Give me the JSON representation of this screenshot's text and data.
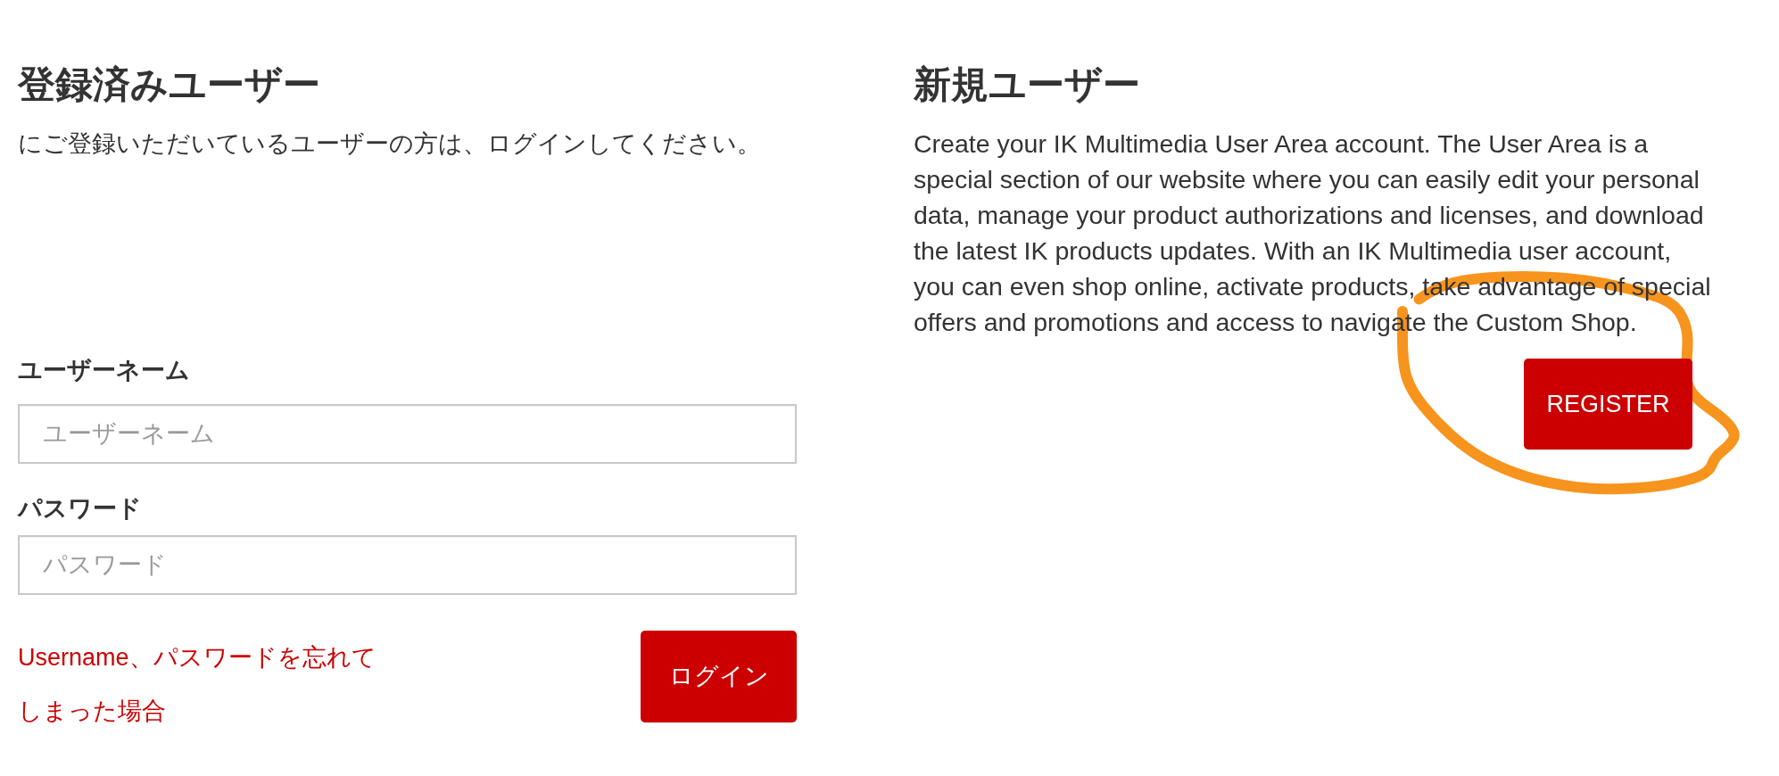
{
  "registered_users": {
    "title": "登録済みユーザー",
    "description": "にご登録いただいているユーザーの方は、ログインしてください。",
    "fields": [
      {
        "label": "ユーザーネーム",
        "placeholder": "ユーザーネーム"
      },
      {
        "label": "パスワード",
        "placeholder": "パスワード"
      }
    ],
    "forgot_link": "Username、パスワードを忘れてしまった場合",
    "login_button": "ログイン"
  },
  "new_users": {
    "title": "新規ユーザー",
    "description": "Create your IK Multimedia User Area account. The User Area is a special section of our website where you can easily edit your personal data, manage your product authorizations and licenses, and download the latest IK products updates. With an IK Multimedia user account, you can even shop online, activate products, take advantage of special offers and promotions and access to navigate the Custom Shop.",
    "register_button": "REGISTER"
  },
  "annotations": [
    {
      "kind": "freehand-loop"
    }
  ]
}
